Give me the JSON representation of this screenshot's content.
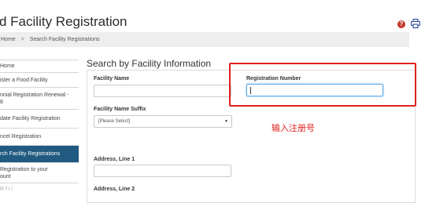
{
  "page": {
    "title": "d Facility Registration"
  },
  "breadcrumb": {
    "home": "Home",
    "separator": ">",
    "current": "Search Facility Registrations"
  },
  "sidebar": {
    "items": [
      {
        "label": "Home"
      },
      {
        "label": "ister a Food Facility"
      },
      {
        "label": "nnial Registration Renewal -"
      },
      {
        "label": "8"
      },
      {
        "label": "date Facility Registration"
      },
      {
        "label": "ncel Registration"
      },
      {
        "label": "rch Facility Registrations"
      },
      {
        "label": "Registration to your"
      },
      {
        "label": "ount"
      },
      {
        "label": "R f i i"
      }
    ]
  },
  "form": {
    "section_title": "Search by Facility Information",
    "facility_name_label": "Facility Name",
    "facility_name_value": "",
    "registration_number_label": "Registration Number",
    "registration_number_value": "",
    "facility_name_suffix_label": "Facility Name Suffix",
    "facility_name_suffix_selected": "[Please Select]",
    "address_line1_label": "Address, Line 1",
    "address_line1_value": "",
    "address_line2_label": "Address, Line 2"
  },
  "annotation": {
    "text": "输入注册号",
    "color": "#e0201f"
  },
  "colors": {
    "active_sidebar": "#205a80",
    "help_icon": "#c0392b",
    "print_icon": "#1a3d8f"
  },
  "icons": {
    "help": "help-icon",
    "print": "printer-icon"
  }
}
